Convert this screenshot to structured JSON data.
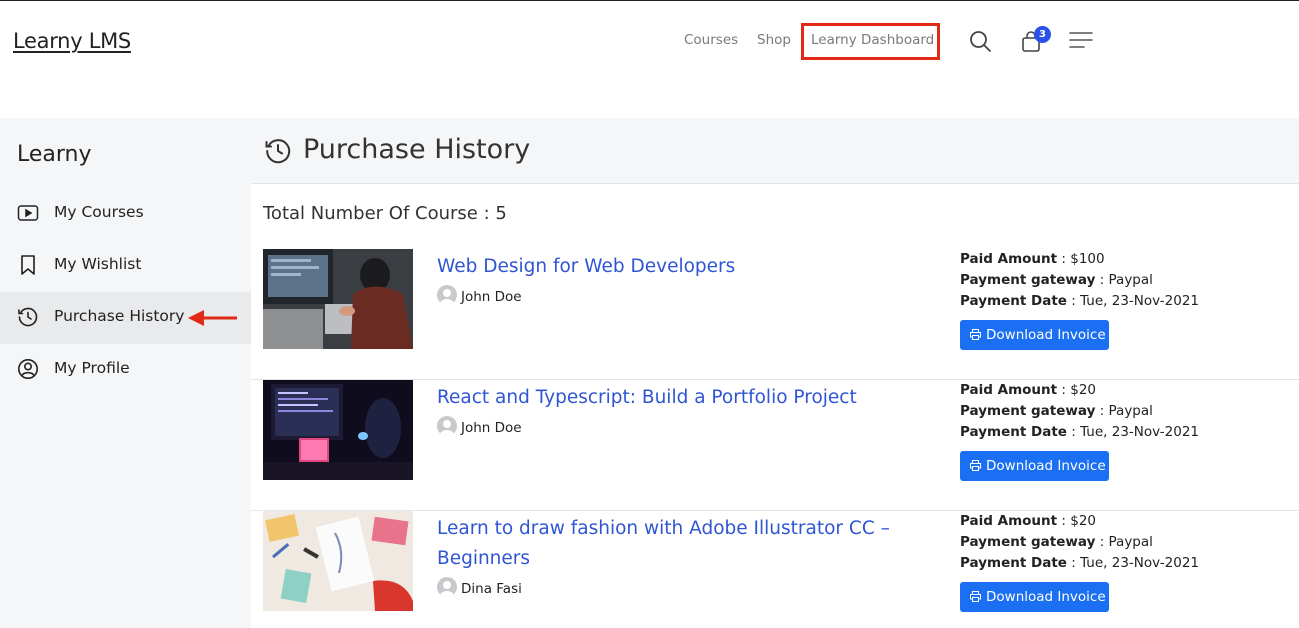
{
  "header": {
    "brand": "Learny LMS",
    "nav": {
      "courses": "Courses",
      "shop": "Shop",
      "dashboard": "Learny Dashboard"
    },
    "cart_count": "3",
    "icons": [
      "search-icon",
      "cart-icon",
      "menu-icon"
    ],
    "highlight_color": "#e12a14"
  },
  "sidebar": {
    "title": "Learny",
    "items": [
      {
        "label": "My Courses",
        "icon": "play-icon"
      },
      {
        "label": "My Wishlist",
        "icon": "bookmark-icon"
      },
      {
        "label": "Purchase History",
        "icon": "history-icon",
        "active": true
      },
      {
        "label": "My Profile",
        "icon": "user-circle-icon"
      }
    ]
  },
  "main": {
    "title": "Purchase History",
    "total": "Total Number Of Course : 5",
    "labels": {
      "paid_amount": "Paid Amount",
      "payment_gateway": "Payment gateway",
      "payment_date": "Payment Date",
      "download": "Download Invoice"
    },
    "purchases": [
      {
        "title": "Web Design for Web Developers",
        "author": "John Doe",
        "amount": "$100",
        "gateway": "Paypal",
        "date": "Tue, 23-Nov-2021"
      },
      {
        "title": "React and Typescript: Build a Portfolio Project",
        "author": "John Doe",
        "amount": "$20",
        "gateway": "Paypal",
        "date": "Tue, 23-Nov-2021"
      },
      {
        "title": "Learn to draw fashion with Adobe Illustrator CC – Beginners",
        "author": "Dina Fasi",
        "amount": "$20",
        "gateway": "Paypal",
        "date": "Tue, 23-Nov-2021"
      }
    ]
  },
  "colors": {
    "link": "#2f55d4",
    "button": "#1a6ff2",
    "badge": "#2b52e8",
    "sidebar_bg": "#f5f6f8",
    "arrow": "#e12a14"
  }
}
